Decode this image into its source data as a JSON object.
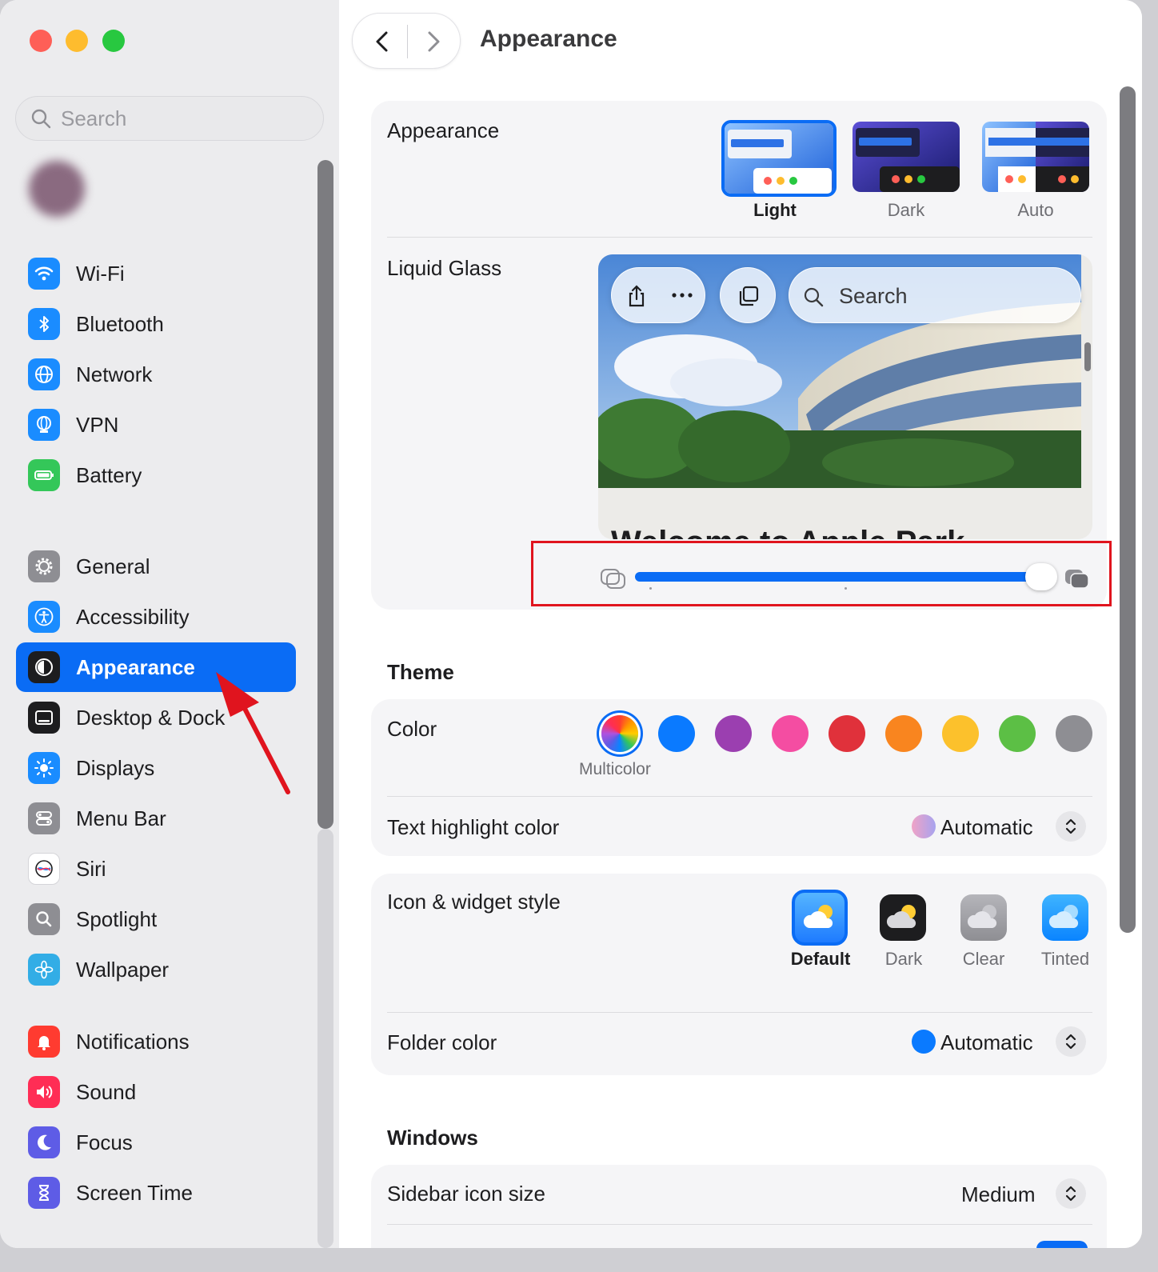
{
  "sidebar": {
    "search_placeholder": "Search",
    "groups": [
      [
        {
          "label": "Wi-Fi",
          "icon": "wifi-icon",
          "color": "#1a8cff"
        },
        {
          "label": "Bluetooth",
          "icon": "bluetooth-icon",
          "color": "#1a8cff"
        },
        {
          "label": "Network",
          "icon": "globe-icon",
          "color": "#1a8cff"
        },
        {
          "label": "VPN",
          "icon": "vpn-globe-icon",
          "color": "#1a8cff"
        },
        {
          "label": "Battery",
          "icon": "battery-icon",
          "color": "#34c759"
        }
      ],
      [
        {
          "label": "General",
          "icon": "gear-icon",
          "color": "#8e8e93"
        },
        {
          "label": "Accessibility",
          "icon": "accessibility-icon",
          "color": "#1a8cff"
        },
        {
          "label": "Appearance",
          "icon": "appearance-icon",
          "color": "#1d1d1f",
          "selected": true
        },
        {
          "label": "Desktop & Dock",
          "icon": "dock-icon",
          "color": "#1d1d1f"
        },
        {
          "label": "Displays",
          "icon": "sun-icon",
          "color": "#1a8cff"
        },
        {
          "label": "Menu Bar",
          "icon": "menubar-icon",
          "color": "#8e8e93"
        },
        {
          "label": "Siri",
          "icon": "siri-icon",
          "color": "#ffffff"
        },
        {
          "label": "Spotlight",
          "icon": "magnifier-icon",
          "color": "#8e8e93"
        },
        {
          "label": "Wallpaper",
          "icon": "flower-icon",
          "color": "#32ade6"
        }
      ],
      [
        {
          "label": "Notifications",
          "icon": "bell-icon",
          "color": "#ff3b30"
        },
        {
          "label": "Sound",
          "icon": "speaker-icon",
          "color": "#ff2d55"
        },
        {
          "label": "Focus",
          "icon": "moon-icon",
          "color": "#5e5ce6"
        },
        {
          "label": "Screen Time",
          "icon": "hourglass-icon",
          "color": "#5e5ce6"
        }
      ]
    ]
  },
  "header": {
    "title": "Appearance"
  },
  "appearance_card": {
    "label": "Appearance",
    "options": [
      {
        "label": "Light",
        "selected": true
      },
      {
        "label": "Dark",
        "selected": false
      },
      {
        "label": "Auto",
        "selected": false
      }
    ],
    "liquid_glass_label": "Liquid Glass",
    "preview_search": "Search",
    "preview_text": "Welcome to Apple Park",
    "liquid_glass_slider": {
      "value": 1.0,
      "min_icon": "clear-glass-icon",
      "max_icon": "tinted-glass-icon"
    }
  },
  "theme": {
    "title": "Theme",
    "color_label": "Color",
    "colors": [
      {
        "name": "multicolor",
        "hex": "multicolor",
        "selected": true
      },
      {
        "name": "blue",
        "hex": "#0a7aff"
      },
      {
        "name": "purple",
        "hex": "#9b3fb0"
      },
      {
        "name": "pink",
        "hex": "#f44da2"
      },
      {
        "name": "red",
        "hex": "#e0313b"
      },
      {
        "name": "orange",
        "hex": "#f9851f"
      },
      {
        "name": "yellow",
        "hex": "#fcc12c"
      },
      {
        "name": "green",
        "hex": "#5cbf45"
      },
      {
        "name": "graphite",
        "hex": "#8e8e93"
      }
    ],
    "color_caption": "Multicolor",
    "text_highlight_label": "Text highlight color",
    "text_highlight_value": "Automatic",
    "icon_style_label": "Icon & widget style",
    "icon_styles": [
      {
        "label": "Default",
        "selected": true
      },
      {
        "label": "Dark"
      },
      {
        "label": "Clear"
      },
      {
        "label": "Tinted"
      }
    ],
    "folder_color_label": "Folder color",
    "folder_color_value": "Automatic"
  },
  "windows": {
    "title": "Windows",
    "sidebar_icon_size_label": "Sidebar icon size",
    "sidebar_icon_size_value": "Medium"
  }
}
